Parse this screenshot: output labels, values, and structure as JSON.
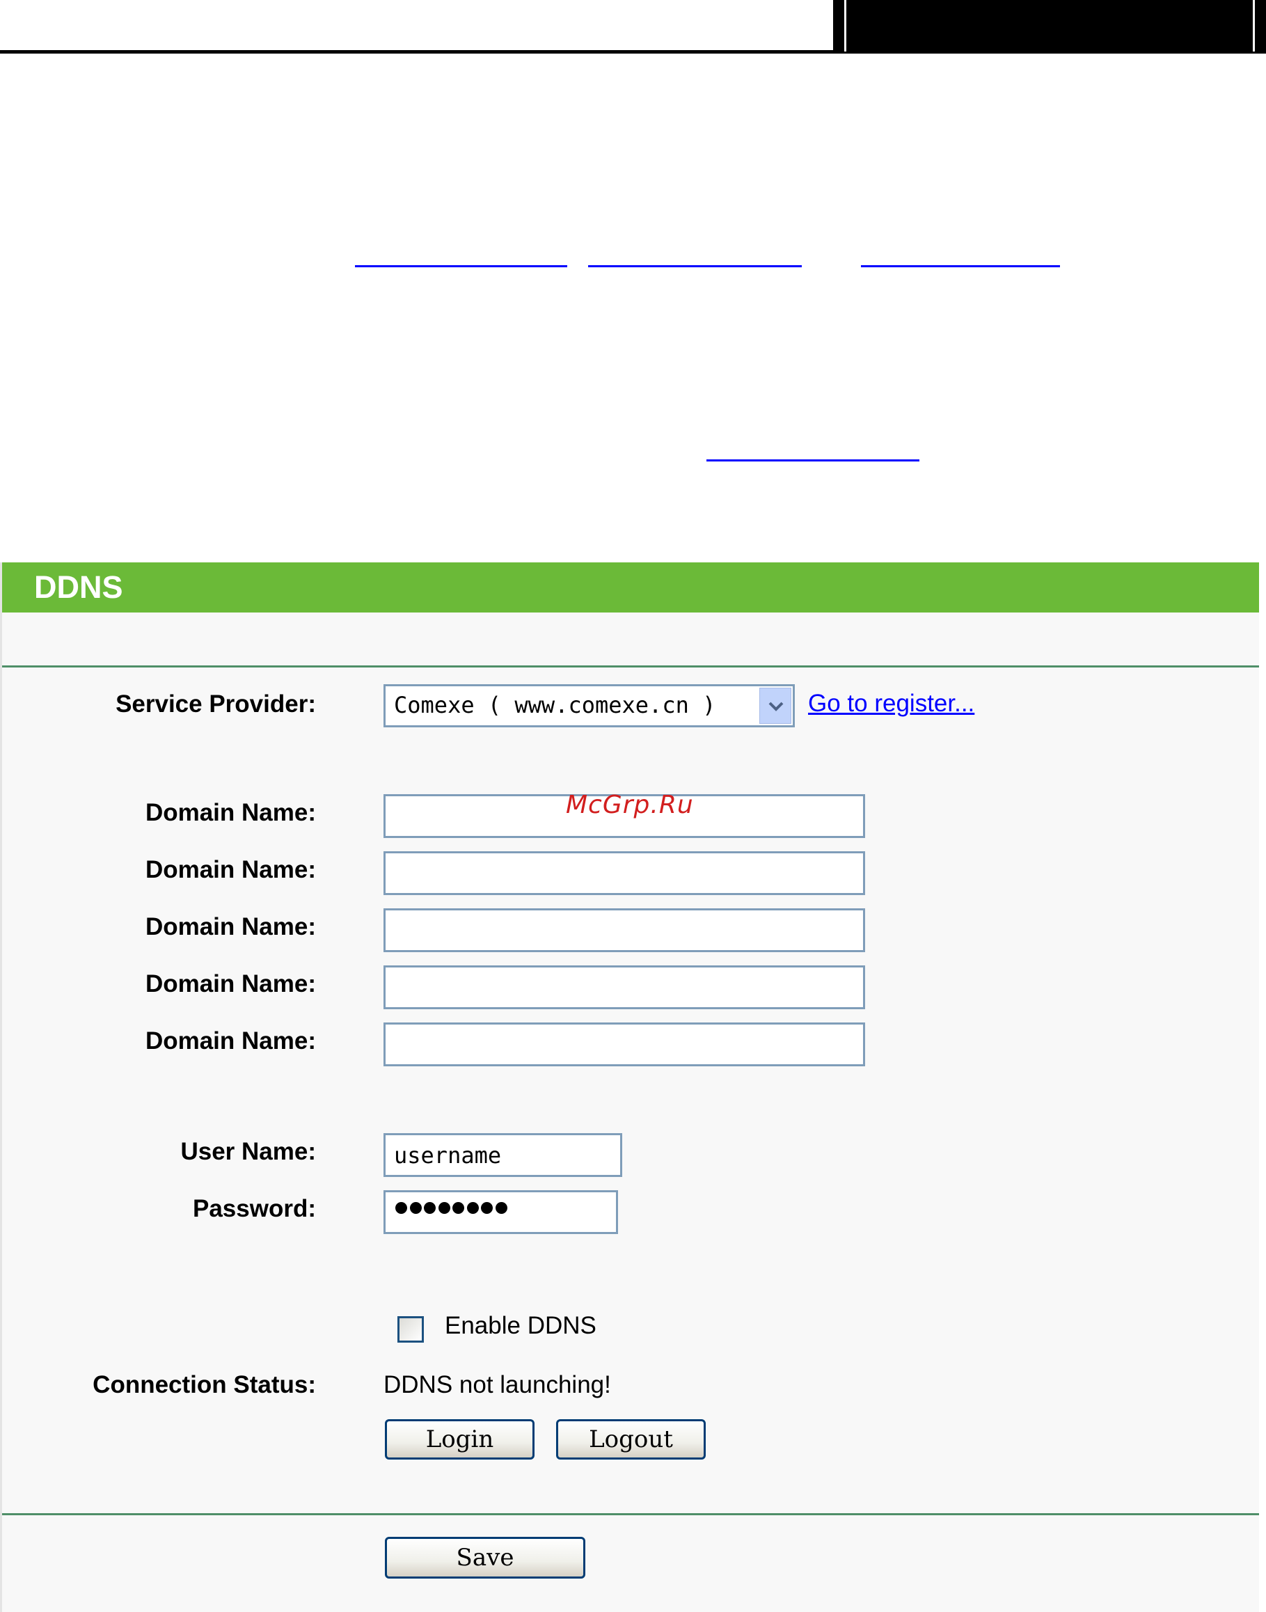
{
  "panel": {
    "title": "DDNS"
  },
  "form": {
    "service_provider_label": "Service Provider:",
    "service_provider_value": "Comexe ( www.comexe.cn )",
    "register_link": "Go to register...",
    "domain_name_label": "Domain Name:",
    "domains": [
      "",
      "",
      "",
      "",
      ""
    ],
    "username_label": "User Name:",
    "username_value": "username",
    "password_label": "Password:",
    "password_length": 8,
    "enable_label": "Enable DDNS",
    "enable_checked": false,
    "connection_status_label": "Connection Status:",
    "connection_status_value": "DDNS not launching!"
  },
  "buttons": {
    "login": "Login",
    "logout": "Logout",
    "save": "Save"
  },
  "watermark": "McGrp.Ru",
  "colors": {
    "title_bar": "#6bba38",
    "rule": "#4f8f68",
    "link": "#0000ff",
    "button_border": "#003c74"
  },
  "icons": {
    "select_arrow": "chevron-down-icon"
  }
}
